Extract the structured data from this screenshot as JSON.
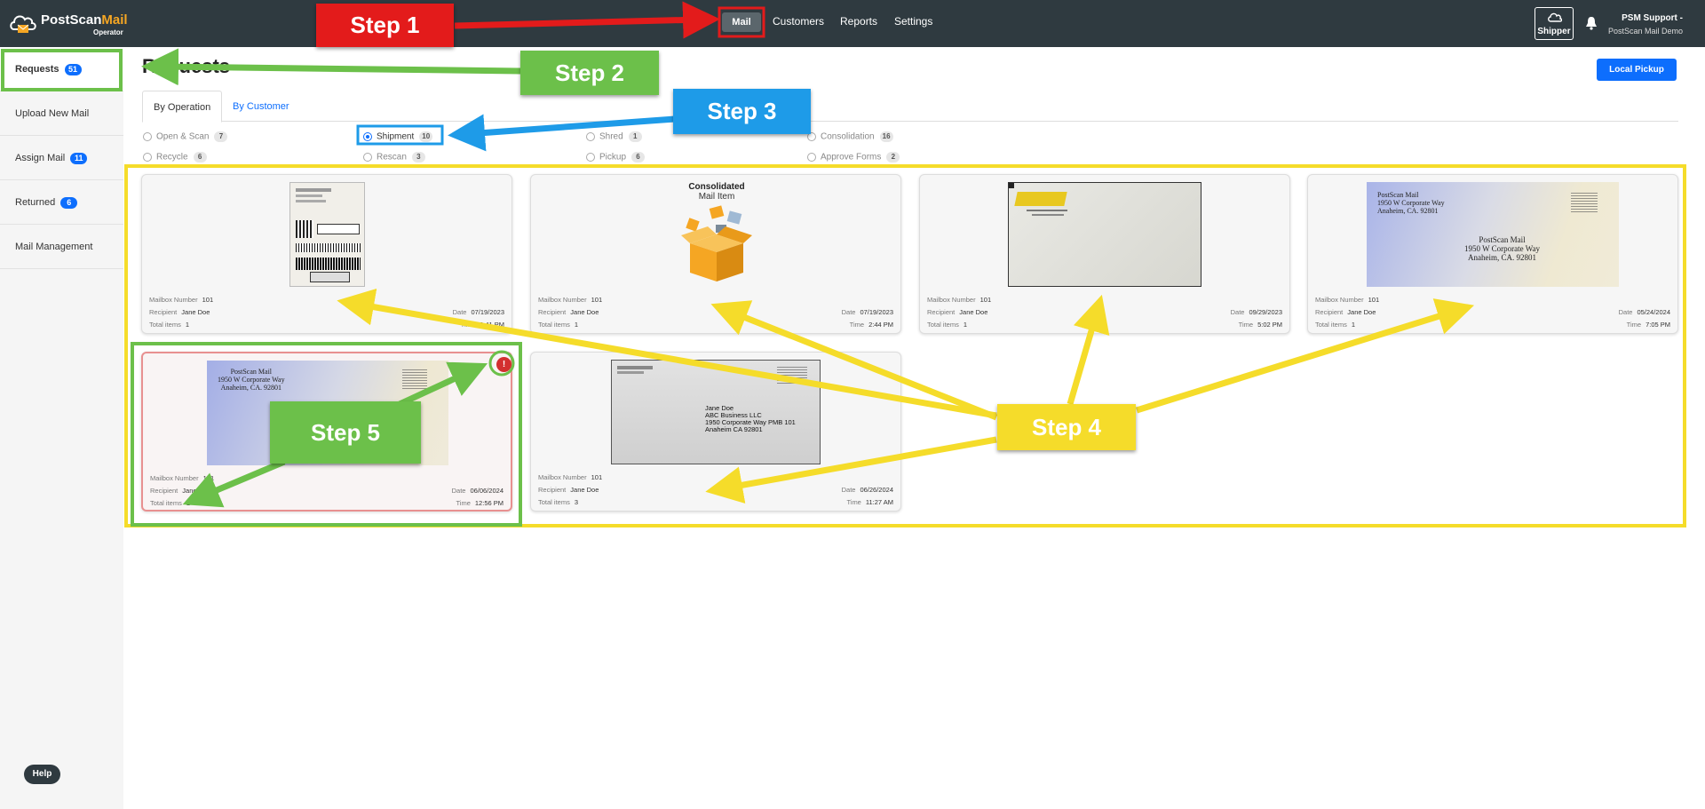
{
  "app": {
    "brand_a": "PostScan",
    "brand_b": "Mail",
    "subtitle": "Operator"
  },
  "nav": {
    "mail": "Mail",
    "customers": "Customers",
    "reports": "Reports",
    "settings": "Settings"
  },
  "header": {
    "shipper": "Shipper",
    "user_name": "PSM Support -",
    "user_org": "PostScan Mail Demo"
  },
  "sidebar": {
    "items": [
      {
        "label": "Requests",
        "badge": "51"
      },
      {
        "label": "Upload New Mail",
        "badge": ""
      },
      {
        "label": "Assign Mail",
        "badge": "11"
      },
      {
        "label": "Returned",
        "badge": "6"
      },
      {
        "label": "Mail Management",
        "badge": ""
      }
    ],
    "help": "Help"
  },
  "main": {
    "title": "Requests",
    "local_pickup": "Local Pickup",
    "tabs": [
      "By Operation",
      "By Customer"
    ],
    "operations": [
      {
        "label": "Open & Scan",
        "count": "7"
      },
      {
        "label": "Shipment",
        "count": "10"
      },
      {
        "label": "Shred",
        "count": "1"
      },
      {
        "label": "Consolidation",
        "count": "16"
      },
      {
        "label": "Recycle",
        "count": "6"
      },
      {
        "label": "Rescan",
        "count": "3"
      },
      {
        "label": "Pickup",
        "count": "6"
      },
      {
        "label": "Approve Forms",
        "count": "2"
      }
    ],
    "labels": {
      "mailbox": "Mailbox Number",
      "recipient": "Recipient",
      "total": "Total items",
      "date": "Date",
      "time": "Time"
    },
    "cards": [
      {
        "mailbox": "101",
        "recipient": "Jane Doe",
        "total": "1",
        "date": "07/19/2023",
        "time": "2:41 PM"
      },
      {
        "mailbox": "101",
        "recipient": "Jane Doe",
        "total": "1",
        "date": "07/19/2023",
        "time": "2:44 PM",
        "thumb_title": "Consolidated",
        "thumb_sub": "Mail Item"
      },
      {
        "mailbox": "101",
        "recipient": "Jane Doe",
        "total": "1",
        "date": "09/29/2023",
        "time": "5:02 PM"
      },
      {
        "mailbox": "101",
        "recipient": "Jane Doe",
        "total": "1",
        "date": "05/24/2024",
        "time": "7:05 PM",
        "env_from": [
          "PostScan Mail",
          "1950 W Corporate Way",
          "Anaheim, CA. 92801"
        ],
        "env_to": [
          "PostScan Mail",
          "1950 W Corporate Way",
          "Anaheim, CA. 92801"
        ]
      },
      {
        "mailbox": "101",
        "recipient": "Jane Doe",
        "total": "1",
        "date": "06/06/2024",
        "time": "12:56 PM",
        "alert": "!",
        "env_from": [
          "PostScan Mail",
          "1950 W Corporate Way",
          "Anaheim, CA. 92801"
        ]
      },
      {
        "mailbox": "101",
        "recipient": "Jane Doe",
        "total": "3",
        "date": "06/26/2024",
        "time": "11:27 AM",
        "env_to": [
          "Jane Doe",
          "ABC Business LLC",
          "1950 Corporate Way PMB 101",
          "Anaheim CA 92801"
        ]
      }
    ]
  },
  "annotations": {
    "step1": "Step 1",
    "step2": "Step 2",
    "step3": "Step 3",
    "step4": "Step 4",
    "step5": "Step 5"
  },
  "colors": {
    "topbar": "#2f3a40",
    "accent": "#0d6efd",
    "step1": "#e31b1b",
    "step2": "#6cc04a",
    "step3": "#1e9be8",
    "step4": "#f5dc2a",
    "step5": "#6cc04a"
  }
}
